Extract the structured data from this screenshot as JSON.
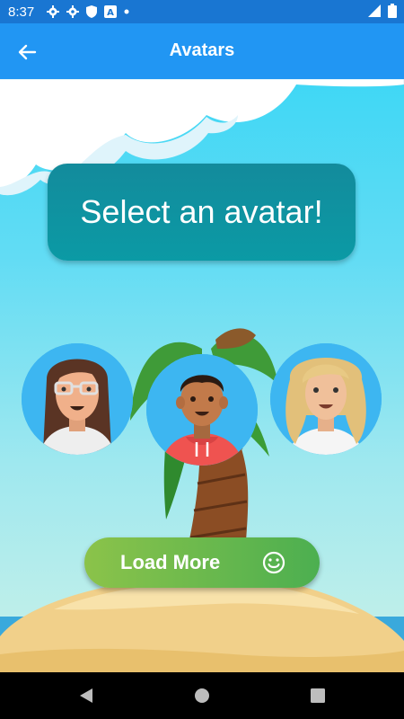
{
  "status_bar": {
    "time": "8:37",
    "left_icons": [
      "gear-icon",
      "gear-icon",
      "shield-icon",
      "a-box-icon",
      "dot-icon"
    ],
    "right_icons": [
      "signal-icon",
      "battery-icon"
    ]
  },
  "app_bar": {
    "title": "Avatars",
    "back_icon": "arrow-back-icon",
    "color": "#2196f3"
  },
  "prompt": {
    "text": "Select an avatar!"
  },
  "avatars": [
    {
      "id": "avatar-glasses-woman",
      "description_icon": "avatar-icon"
    },
    {
      "id": "avatar-hoodie-man",
      "description_icon": "avatar-icon"
    },
    {
      "id": "avatar-blonde-woman",
      "description_icon": "avatar-icon"
    }
  ],
  "load_more": {
    "label": "Load More",
    "icon": "smile-icon",
    "color_start": "#8bc34a",
    "color_end": "#4caf50"
  },
  "nav_bar": {
    "icons": [
      "back-triangle-icon",
      "home-circle-icon",
      "recents-square-icon"
    ]
  }
}
